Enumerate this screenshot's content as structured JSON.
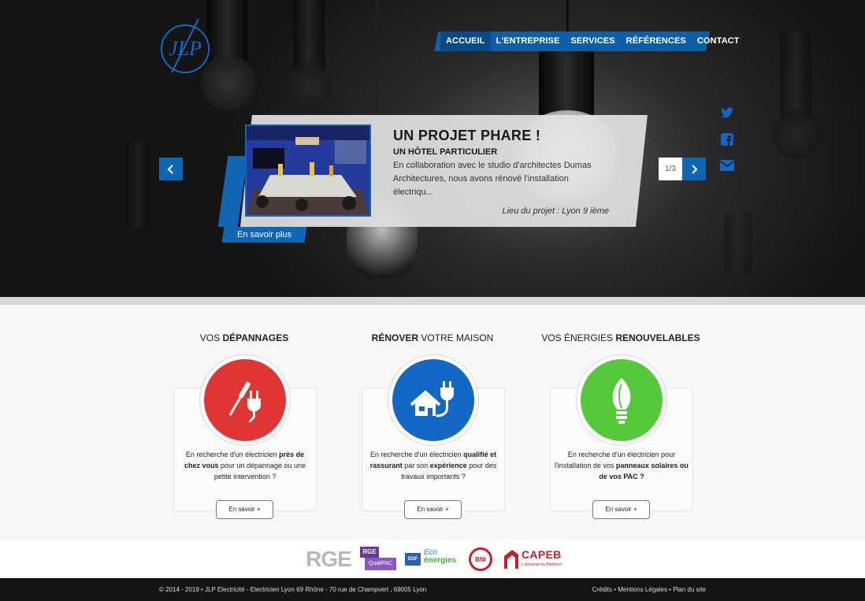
{
  "logo": {
    "text": "JLP"
  },
  "nav": {
    "items": [
      {
        "label": "ACCUEIL",
        "active": true
      },
      {
        "label": "L'ENTREPRISE",
        "active": false
      },
      {
        "label": "SERVICES",
        "active": false
      },
      {
        "label": "RÉFÉRENCES",
        "active": false
      },
      {
        "label": "CONTACT",
        "active": false
      }
    ]
  },
  "social": [
    "twitter-icon",
    "facebook-icon",
    "envelope-icon"
  ],
  "slider": {
    "counter": "1/3",
    "title": "UN PROJET PHARE !",
    "subtitle": "UN HÔTEL PARTICULIER",
    "text": "En collaboration avec le studio d'architectes Dumas Architectures, nous avons rénové l'installation électriqu...",
    "location": "Lieu du projet : Lyon 9 ième",
    "more_label": "En savoir plus"
  },
  "services": [
    {
      "title_pre": "VOS ",
      "title_bold": "DÉPANNAGES",
      "title_post": "",
      "icon": "plug-screwdriver-icon",
      "color": "#e03535",
      "text_a": "En recherche d'un électricien ",
      "text_b": "près de chez vous",
      "text_c": " pour un dépannage ou une petite intervention ?",
      "button": "En savoir +"
    },
    {
      "title_pre": "",
      "title_bold": "RÉNOVER",
      "title_post": " VOTRE MAISON",
      "icon": "house-plug-icon",
      "color": "#1268c4",
      "text_a": "En recherche d'un électricien ",
      "text_b": "qualifié et rassurant",
      "text_c": " par son ",
      "text_d": "expérience",
      "text_e": " pour des travaux importants ?",
      "button": "En savoir +"
    },
    {
      "title_pre": "VOS ÉNERGIES ",
      "title_bold": "RENOUVELABLES",
      "title_post": "",
      "icon": "leaf-bulb-icon",
      "color": "#55c93a",
      "text_a": "En recherche d'un électricien pour l'installation de vos ",
      "text_b": "panneaux solaires ou de vos PAC ?",
      "button": "En savoir +"
    }
  ],
  "partners": [
    {
      "name": "RGE",
      "label": "RGE"
    },
    {
      "name": "RGE QualiPAC",
      "label": "RGE",
      "label2": "QualiPAC"
    },
    {
      "name": "Eco Energies",
      "label": "EDF",
      "label2": "Eco",
      "label3": "énergies"
    },
    {
      "name": "BNI",
      "label": "BNI"
    },
    {
      "name": "CAPEB",
      "label": "CAPEB",
      "label2": "L'artisanat du Bâtiment"
    }
  ],
  "footer": {
    "left": "© 2014 - 2019 • JLP Electricité - Electricien Lyon 69 Rhône - 70 rue de Champvert , 69005 Lyon",
    "right": "Crédits • Mentions Légales • Plan du site"
  }
}
